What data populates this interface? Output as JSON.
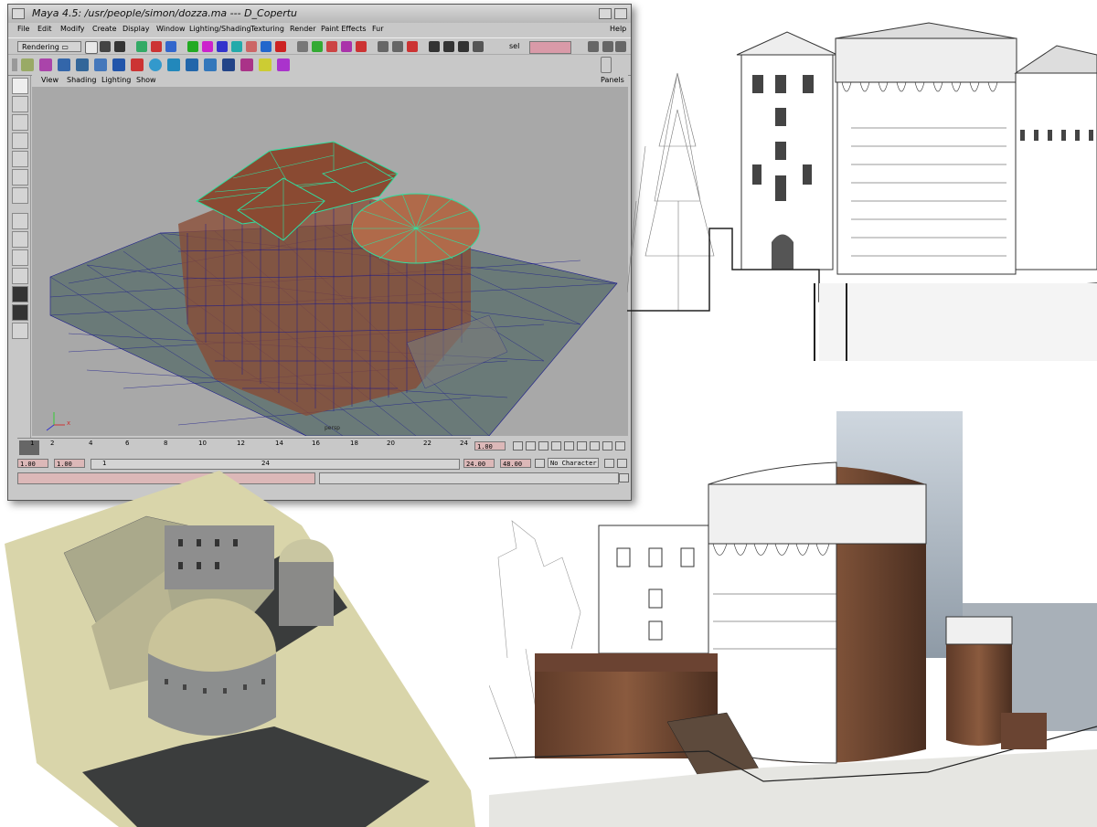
{
  "window": {
    "title": "Maya 4.5: /usr/people/simon/dozza.ma  ---  D_Copertu",
    "help": "Help"
  },
  "menu": [
    "File",
    "Edit",
    "Modify",
    "Create",
    "Display",
    "Window",
    "Lighting/Shading",
    "Texturing",
    "Render",
    "Paint Effects",
    "Fur"
  ],
  "shelf": {
    "mode": "Rendering",
    "sel_label": "sel"
  },
  "panel_menu": [
    "View",
    "Shading",
    "Lighting",
    "Show"
  ],
  "panels_label": "Panels",
  "viewport": {
    "axis_label": "x",
    "persp_label": "persp"
  },
  "timeline": {
    "ticks": [
      "2",
      "4",
      "6",
      "8",
      "10",
      "12",
      "14",
      "16",
      "18",
      "20",
      "22",
      "24"
    ],
    "current_frame": "1.00",
    "first_tick": "1"
  },
  "range": {
    "start": "1.00",
    "start2": "1.00",
    "slider_start": "1",
    "slider_end": "24",
    "end": "24.00",
    "end2": "48.00",
    "character": "No Character"
  },
  "colors": {
    "wire": "#1a1a8c",
    "roof_wire": "#30e0a0",
    "terrain": "#6a7a78",
    "brick": "#8a4a32"
  }
}
